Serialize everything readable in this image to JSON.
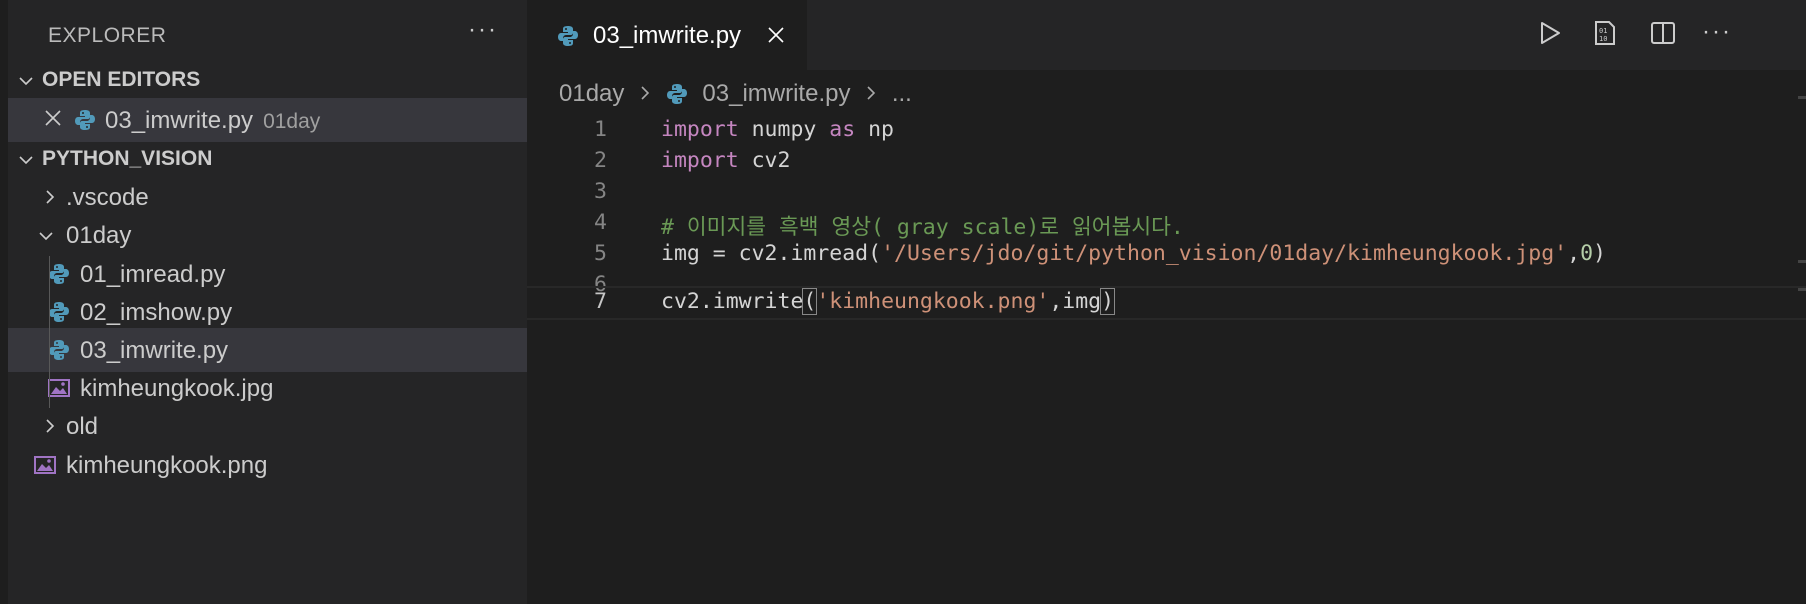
{
  "sidebar": {
    "title": "EXPLORER",
    "more_icon": "ellipsis-icon",
    "open_editors": {
      "label": "OPEN EDITORS",
      "items": [
        {
          "name": "03_imwrite.py",
          "desc": "01day"
        }
      ]
    },
    "workspace": {
      "label": "PYTHON_VISION",
      "tree": [
        {
          "label": ".vscode",
          "type": "folder",
          "expanded": false
        },
        {
          "label": "01day",
          "type": "folder",
          "expanded": true
        },
        {
          "label": "01_imread.py",
          "type": "python"
        },
        {
          "label": "02_imshow.py",
          "type": "python"
        },
        {
          "label": "03_imwrite.py",
          "type": "python",
          "selected": true
        },
        {
          "label": "kimheungkook.jpg",
          "type": "image"
        },
        {
          "label": "old",
          "type": "folder",
          "expanded": false
        },
        {
          "label": "kimheungkook.png",
          "type": "image"
        }
      ]
    }
  },
  "editor": {
    "tab": {
      "label": "03_imwrite.py"
    },
    "actions": [
      "run-icon",
      "binary-file-icon",
      "split-editor-icon",
      "more-actions-icon"
    ],
    "breadcrumb": {
      "folder": "01day",
      "file": "03_imwrite.py",
      "more": "..."
    },
    "line_numbers": [
      "1",
      "2",
      "3",
      "4",
      "5",
      "6",
      "7"
    ],
    "code": {
      "l1": {
        "kw1": "import",
        "t1": " numpy ",
        "kw2": "as",
        "t2": " np"
      },
      "l2": {
        "kw1": "import",
        "t1": " cv2"
      },
      "l4": {
        "comment": "# 이미지를 흑백 영상( gray scale)로 읽어봅시다."
      },
      "l5": {
        "t1": "img = cv2.imread(",
        "s1": "'/Users/jdo/git/python_vision/01day/kimheungkook.jpg'",
        "t2": ",",
        "n1": "0",
        "t3": ")"
      },
      "l7": {
        "t1": "cv2.imwrite",
        "p1": "(",
        "s1": "'kimheungkook.png'",
        "t2": ",img",
        "p2": ")"
      }
    }
  },
  "colors": {
    "background": "#1e1e1e",
    "sidebar": "#252526",
    "keyword": "#c586c0",
    "string": "#ce9178",
    "number": "#b5cea8",
    "comment": "#6a9955",
    "python_icon": "#519aba",
    "image_icon": "#a074c4"
  }
}
